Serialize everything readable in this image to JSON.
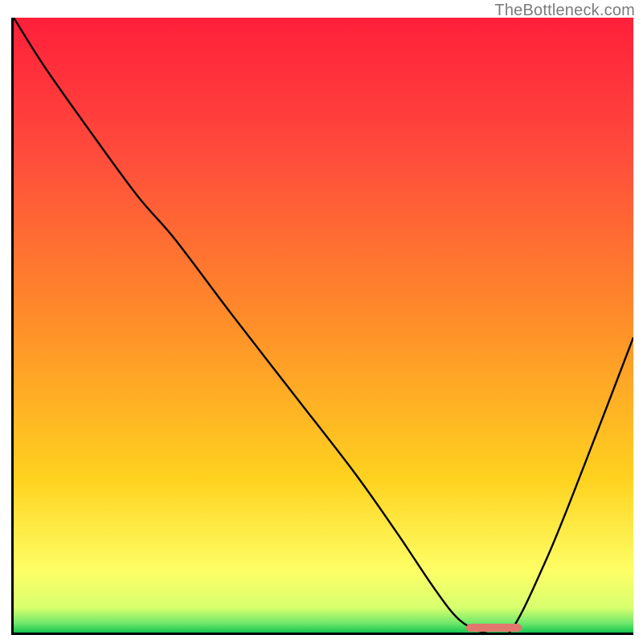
{
  "watermark": "TheBottleneck.com",
  "colors": {
    "grad": [
      "#ff1f3a",
      "#ff4b3c",
      "#ff8a2a",
      "#ffd21f",
      "#feff66",
      "#d7ff6e",
      "#6fe86b",
      "#17c64e"
    ],
    "curve": "#000000",
    "marker": "#e2776d"
  },
  "chart_data": {
    "type": "line",
    "title": "",
    "xlabel": "",
    "ylabel": "",
    "xlim": [
      0,
      100
    ],
    "ylim": [
      0,
      100
    ],
    "x": [
      0,
      5,
      12,
      20,
      26,
      35,
      45,
      55,
      62,
      68,
      72,
      76,
      80,
      86,
      92,
      100
    ],
    "values": [
      100,
      92,
      82,
      71,
      64,
      52,
      39,
      26,
      16,
      7,
      2,
      0,
      0,
      12,
      27,
      48
    ],
    "optimum_range_x": [
      73,
      82
    ],
    "annotations": []
  }
}
